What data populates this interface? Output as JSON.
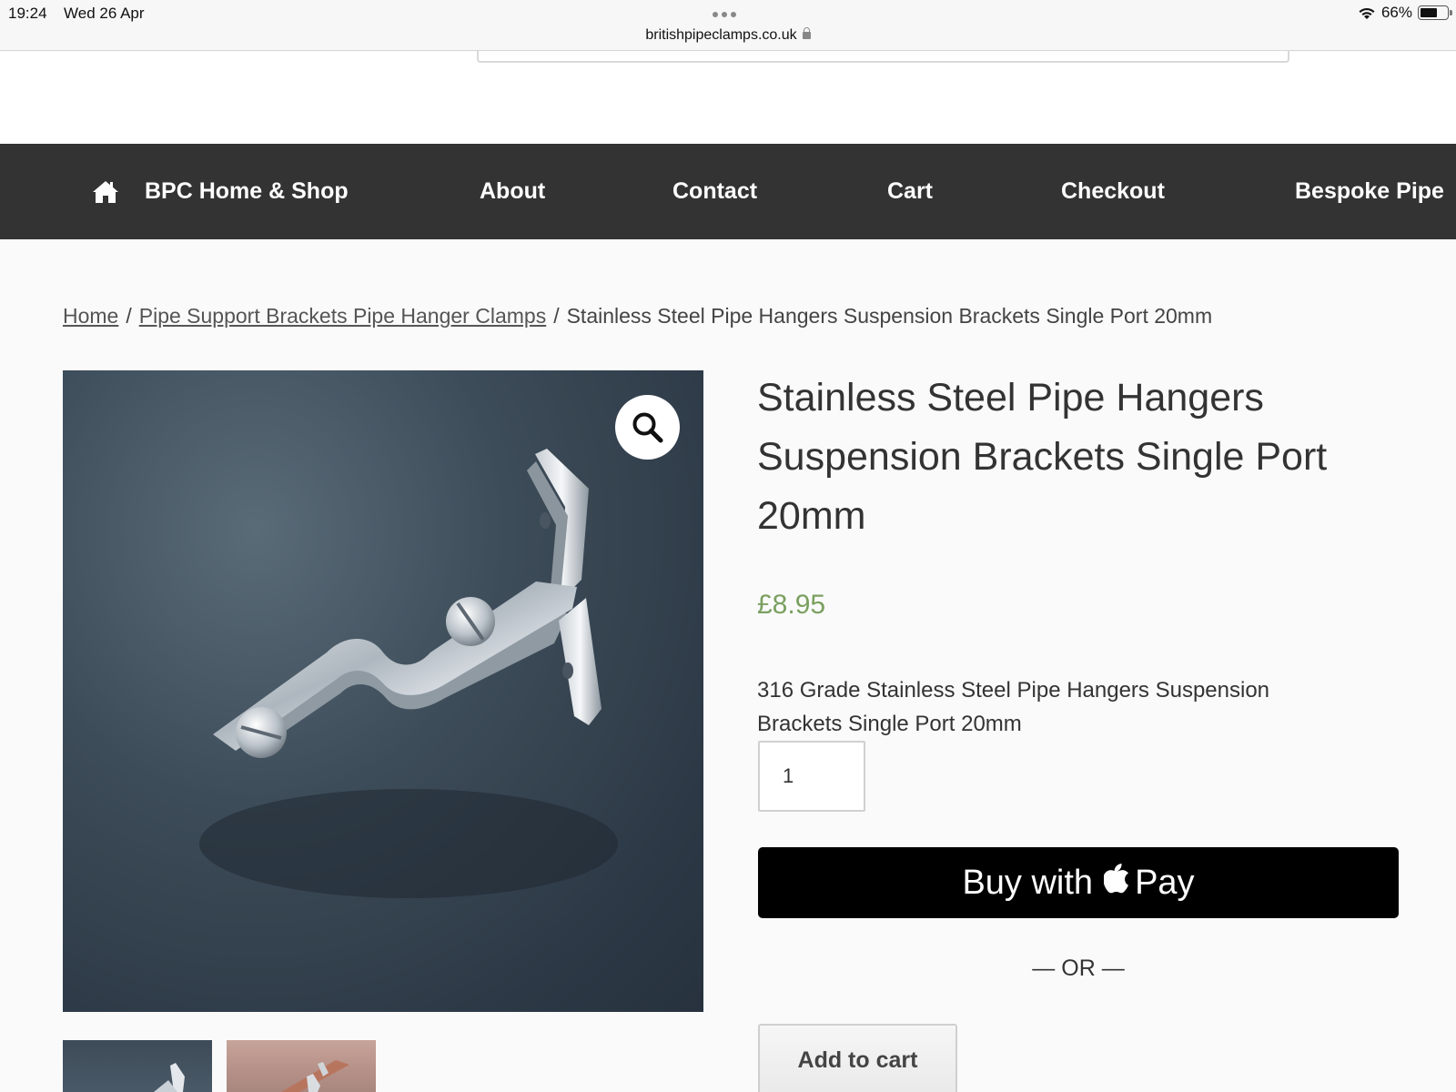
{
  "status_bar": {
    "time": "19:24",
    "date": "Wed 26 Apr",
    "url": "britishpipeclamps.co.uk",
    "battery": "66%",
    "battery_level": 0.66
  },
  "nav": {
    "items": [
      {
        "label": "BPC Home & Shop",
        "icon": "home-icon"
      },
      {
        "label": "About"
      },
      {
        "label": "Contact"
      },
      {
        "label": "Cart"
      },
      {
        "label": "Checkout"
      },
      {
        "label": "Bespoke Pipe"
      }
    ]
  },
  "breadcrumb": {
    "home": "Home",
    "separator": "/",
    "category": "Pipe Support Brackets Pipe Hanger Clamps",
    "current": "Stainless Steel Pipe Hangers Suspension Brackets Single Port 20mm"
  },
  "product": {
    "title": "Stainless Steel Pipe Hangers Suspension Brackets Single Port 20mm",
    "price": "£8.95",
    "description": "316 Grade Stainless Steel Pipe Hangers Suspension Brackets Single Port 20mm",
    "quantity": "1",
    "buy_label": "Buy with",
    "pay_label": "Pay",
    "or_label": "— OR —",
    "add_to_cart": "Add to cart"
  },
  "colors": {
    "nav_bg": "#333333",
    "price": "#7aa060",
    "buy_button": "#000000"
  }
}
